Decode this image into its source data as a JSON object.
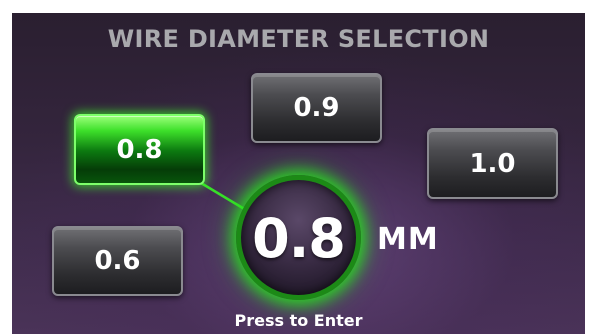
{
  "screen": {
    "title": "WIRE DIAMETER SELECTION",
    "options": [
      {
        "id": "opt-09",
        "label": "0.9",
        "selected": false
      },
      {
        "id": "opt-08",
        "label": "0.8",
        "selected": true
      },
      {
        "id": "opt-10",
        "label": "1.0",
        "selected": false
      },
      {
        "id": "opt-06",
        "label": "0.6",
        "selected": false
      }
    ],
    "current_value": "0.8",
    "unit": "MM",
    "hint": "Press to Enter"
  },
  "colors": {
    "selected_accent": "#3de02a",
    "title_text": "#a9a9ad",
    "background": "#34253d"
  }
}
